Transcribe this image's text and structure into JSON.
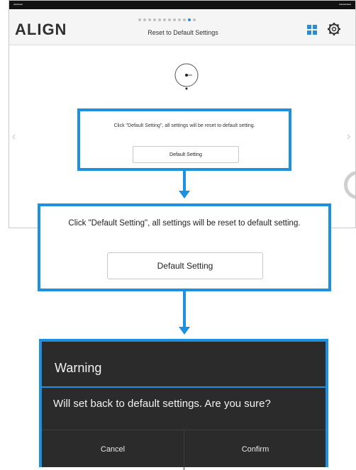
{
  "app": {
    "logo_text": "ALIGN",
    "title": "Reset to Default Settings",
    "step_indicator": {
      "total": 12,
      "active": 11
    },
    "icons": [
      "grid-icon",
      "gear-icon",
      "dial-icon",
      "chevron-left-icon",
      "chevron-right-icon"
    ]
  },
  "panel_small": {
    "message": "Click \"Default Setting\", all settings will be reset to default setting.",
    "button_label": "Default Setting"
  },
  "panel_zoom": {
    "message": "Click \"Default Setting\", all settings will be reset to default setting.",
    "button_label": "Default Setting"
  },
  "dialog": {
    "title": "Warning",
    "message": "Will set back to default settings. Are you sure?",
    "cancel_label": "Cancel",
    "confirm_label": "Confirm"
  },
  "colors": {
    "accent": "#1e90e0",
    "dialog_bg": "#2b2b2b"
  }
}
